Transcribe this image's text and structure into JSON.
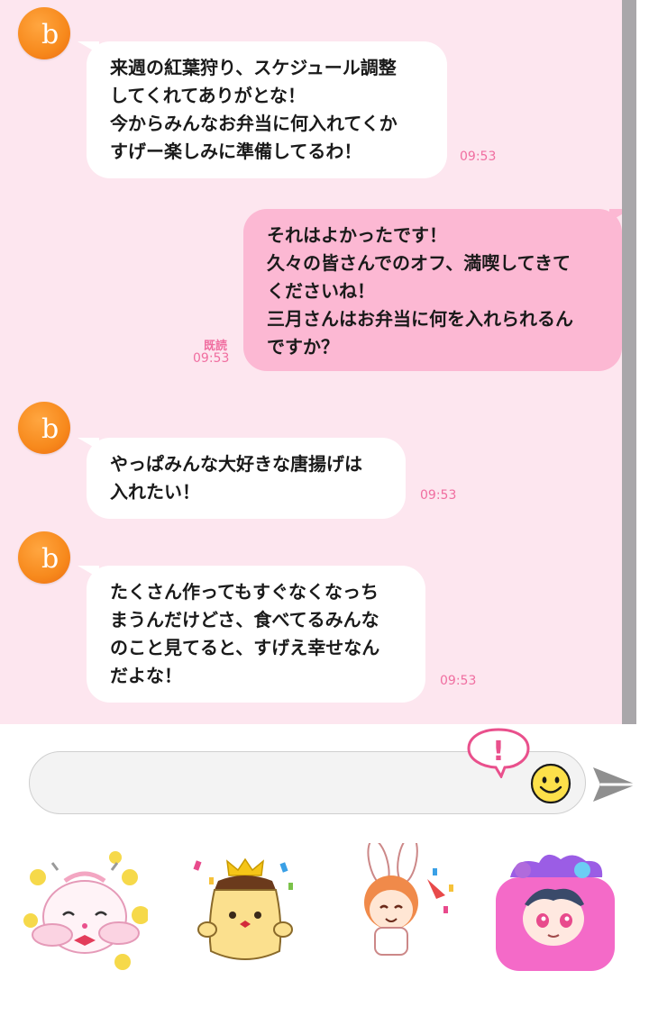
{
  "messages": [
    {
      "side": "left",
      "lines": "来週の紅葉狩り、スケジュール調整\nしてくれてありがとな！\n今からみんなお弁当に何入れてくか\nすげー楽しみに準備してるわ！",
      "time": "09:53"
    },
    {
      "side": "right",
      "lines": "それはよかったです！\n久々の皆さんでのオフ、満喫してきて\nくださいね！\n三月さんはお弁当に何を入れられるん\nですか？",
      "time": "09:53",
      "read": "既読"
    },
    {
      "side": "left",
      "lines": "やっぱみんな大好きな唐揚げは\n入れたい！",
      "time": "09:53"
    },
    {
      "side": "left",
      "lines": "たくさん作ってもすぐなくなっち\nまうんだけどさ、食べてるみんな\nのこと見てると、すげえ幸せなん\nだよな！",
      "time": "09:53"
    }
  ],
  "composer": {
    "placeholder": "",
    "value": "",
    "alert_symbol": "!"
  },
  "avatar": {
    "glyph": "b",
    "color": "#f7891c"
  },
  "icons": {
    "emoji": "smiley-icon",
    "send": "send-arrow-icon",
    "alert": "exclamation-bubble-icon"
  },
  "stickers": [
    "bunny-sticker",
    "pudding-king-sticker",
    "bunny-boy-sticker",
    "pink-blanket-boy-sticker"
  ],
  "colors": {
    "chat_bg": "#fde6ef",
    "bubble_self": "#fcb8d3",
    "bubble_other": "#ffffff",
    "time_text": "#f06ea0"
  }
}
